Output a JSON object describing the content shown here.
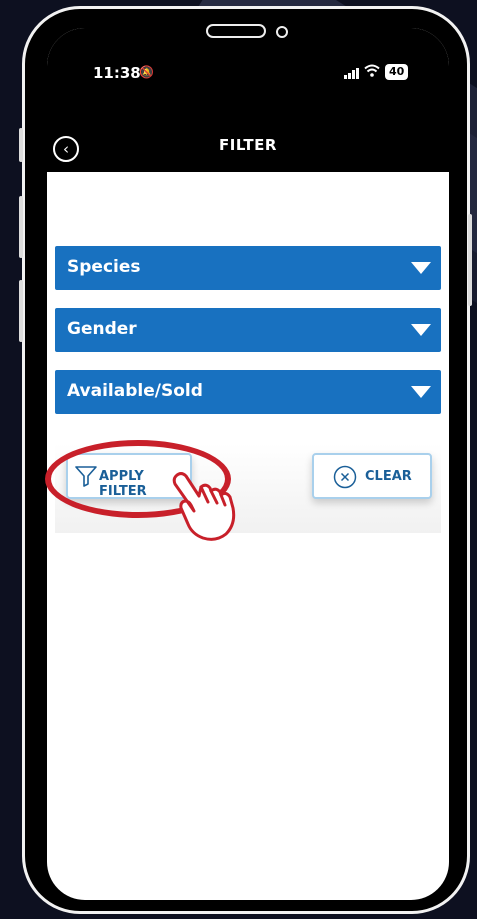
{
  "status_bar": {
    "time": "11:38",
    "battery": "40"
  },
  "nav": {
    "title": "FILTER"
  },
  "filters": [
    {
      "label": "Species"
    },
    {
      "label": "Gender"
    },
    {
      "label": "Available/Sold"
    }
  ],
  "actions": {
    "apply_label": "APPLY FILTER",
    "clear_label": "CLEAR"
  },
  "colors": {
    "accent": "#1871c0",
    "highlight": "#c8202a",
    "button_text": "#1a5f98"
  }
}
